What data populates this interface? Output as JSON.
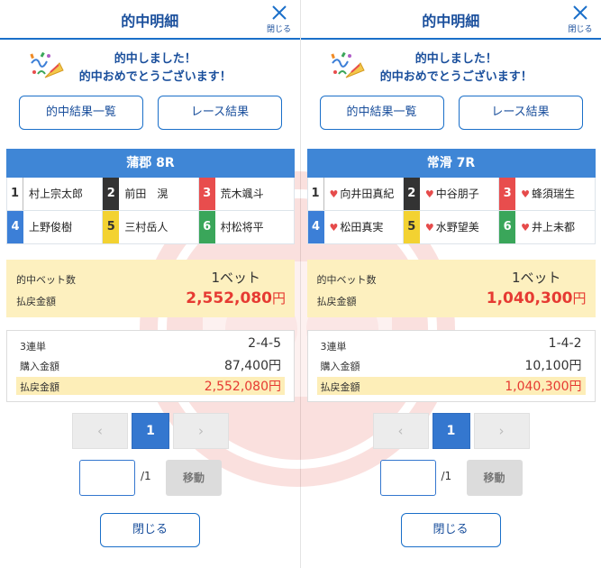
{
  "header": {
    "title": "的中明細",
    "close_label": "閉じる"
  },
  "congrats": {
    "line1": "的中しました！",
    "line2": "的中おめでとうございます！"
  },
  "buttons": {
    "hit_list": "的中結果一覧",
    "race_result": "レース結果",
    "close": "閉じる",
    "move": "移動"
  },
  "pagination": {
    "prev": "‹",
    "current": "1",
    "next": "›",
    "total": "/1"
  },
  "colors": {
    "accent": "#1a6fc9",
    "race_header": "#3f86d6",
    "payout": "#e63a32",
    "highlight": "#fdf0bf"
  },
  "panels": [
    {
      "race": "蒲郡 8R",
      "players": [
        {
          "num": "1",
          "name": "村上宗太郎",
          "heart": false
        },
        {
          "num": "2",
          "name": "前田　滉",
          "heart": false
        },
        {
          "num": "3",
          "name": "荒木颯斗",
          "heart": false
        },
        {
          "num": "4",
          "name": "上野俊樹",
          "heart": false
        },
        {
          "num": "5",
          "name": "三村岳人",
          "heart": false
        },
        {
          "num": "6",
          "name": "村松将平",
          "heart": false
        }
      ],
      "summary": {
        "bets_label": "的中ベット数",
        "bets_value": "1ベット",
        "payout_label": "払戻金額",
        "payout_value": "2,552,080",
        "yen": "円"
      },
      "detail": {
        "type_label": "3連単",
        "combo": "2-4-5",
        "purchase_label": "購入金額",
        "purchase_value": "87,400円",
        "payout_label": "払戻金額",
        "payout_value": "2,552,080円"
      }
    },
    {
      "race": "常滑 7R",
      "players": [
        {
          "num": "1",
          "name": "向井田真紀",
          "heart": true
        },
        {
          "num": "2",
          "name": "中谷朋子",
          "heart": true
        },
        {
          "num": "3",
          "name": "蜂須瑞生",
          "heart": true
        },
        {
          "num": "4",
          "name": "松田真実",
          "heart": true
        },
        {
          "num": "5",
          "name": "水野望美",
          "heart": true
        },
        {
          "num": "6",
          "name": "井上未都",
          "heart": true
        }
      ],
      "summary": {
        "bets_label": "的中ベット数",
        "bets_value": "1ベット",
        "payout_label": "払戻金額",
        "payout_value": "1,040,300",
        "yen": "円"
      },
      "detail": {
        "type_label": "3連単",
        "combo": "1-4-2",
        "purchase_label": "購入金額",
        "purchase_value": "10,100円",
        "payout_label": "払戻金額",
        "payout_value": "1,040,300円"
      }
    }
  ]
}
